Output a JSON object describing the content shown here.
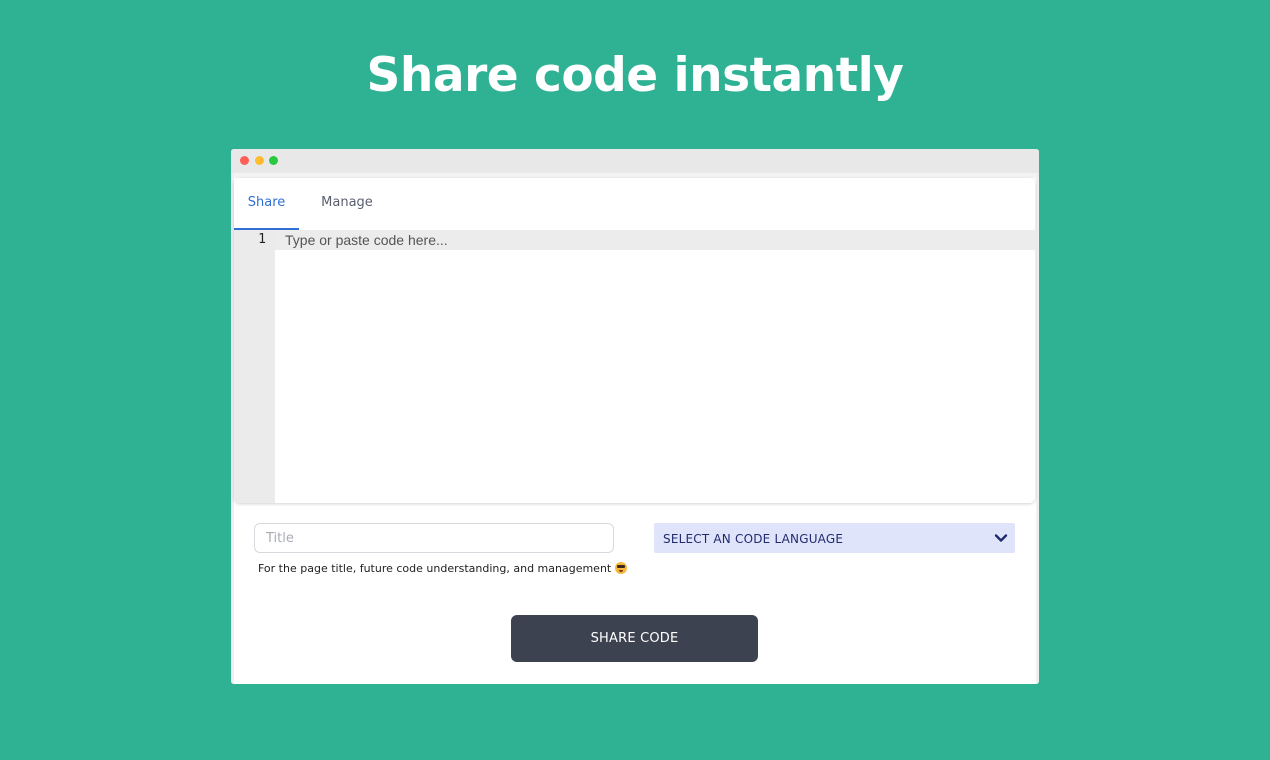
{
  "headline": "Share code instantly",
  "tabs": [
    {
      "label": "Share",
      "active": true
    },
    {
      "label": "Manage",
      "active": false
    }
  ],
  "editor": {
    "line_number": "1",
    "placeholder": "Type or paste code here..."
  },
  "form": {
    "title_placeholder": "Title",
    "help_text": "For the page title, future code understanding, and management",
    "language_select_label": "SELECT AN CODE LANGUAGE",
    "share_button_label": "SHARE CODE"
  },
  "icons": {
    "emoji": "smiling-face-with-sunglasses-icon",
    "dropdown": "chevron-down-icon"
  },
  "colors": {
    "background": "#2fb294",
    "active_tab": "#2f6fd6",
    "select_bg": "#e0e4fa",
    "button_bg": "#3d4250"
  }
}
